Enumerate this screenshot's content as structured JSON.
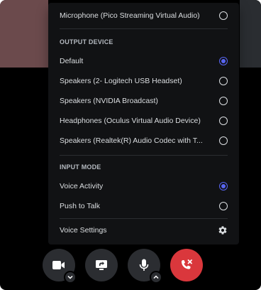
{
  "menu": {
    "input_device_item": {
      "label": "Microphone (Pico Streaming Virtual Audio)",
      "selected": false
    },
    "output_header": "OUTPUT DEVICE",
    "output_devices": [
      {
        "label": "Default",
        "selected": true
      },
      {
        "label": "Speakers (2- Logitech USB Headset)",
        "selected": false
      },
      {
        "label": "Speakers (NVIDIA Broadcast)",
        "selected": false
      },
      {
        "label": "Headphones (Oculus Virtual Audio Device)",
        "selected": false
      },
      {
        "label": "Speakers (Realtek(R) Audio Codec with T...",
        "selected": false
      }
    ],
    "input_mode_header": "INPUT MODE",
    "input_modes": [
      {
        "label": "Voice Activity",
        "selected": true
      },
      {
        "label": "Push to Talk",
        "selected": false
      }
    ],
    "voice_settings_label": "Voice Settings"
  },
  "controls": {
    "camera": "video-camera-icon",
    "screen_share": "screen-share-icon",
    "microphone": "microphone-icon",
    "disconnect": "disconnect-call-icon"
  },
  "colors": {
    "menu_bg": "#111214",
    "accent": "#5865f2",
    "disconnect_red": "#da373c",
    "button_bg": "#2b2d31",
    "text": "#dbdee1"
  }
}
